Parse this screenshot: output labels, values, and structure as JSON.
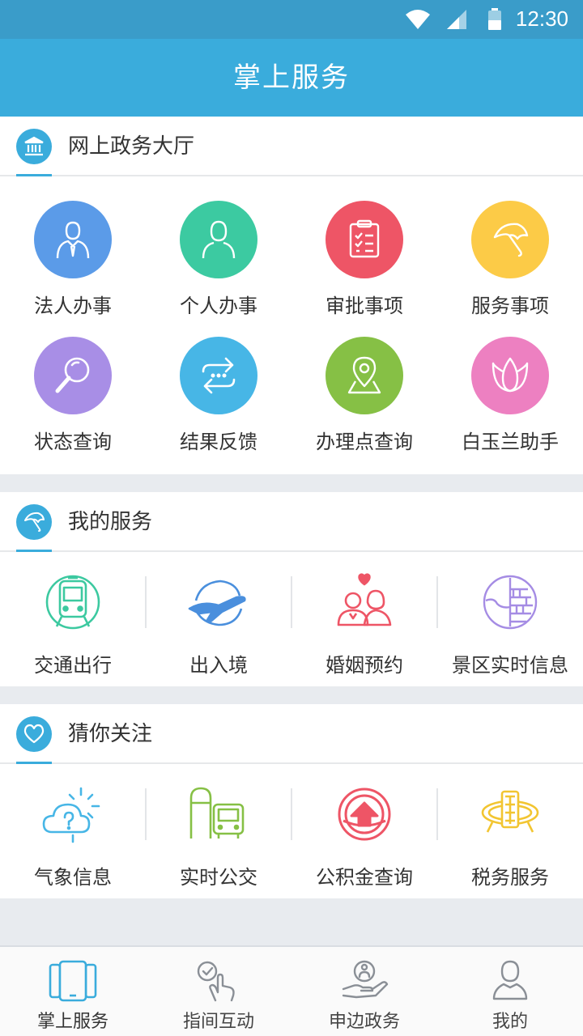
{
  "status_bar": {
    "time": "12:30",
    "icons": [
      "wifi-icon",
      "signal-icon",
      "battery-icon"
    ]
  },
  "header": {
    "title": "掌上服务"
  },
  "hall": {
    "title": "网上政务大厅",
    "icon": "government-building-icon",
    "items": [
      {
        "label": "法人办事",
        "icon": "businessman-icon",
        "color": "#5b9be8"
      },
      {
        "label": "个人办事",
        "icon": "person-icon",
        "color": "#3ccaa1"
      },
      {
        "label": "审批事项",
        "icon": "clipboard-checklist-icon",
        "color": "#ee5566"
      },
      {
        "label": "服务事项",
        "icon": "umbrella-icon",
        "color": "#fccb47"
      },
      {
        "label": "状态查询",
        "icon": "magnifier-icon",
        "color": "#a88ee6"
      },
      {
        "label": "结果反馈",
        "icon": "exchange-arrows-icon",
        "color": "#47b6e6"
      },
      {
        "label": "办理点查询",
        "icon": "map-pin-icon",
        "color": "#86c045"
      },
      {
        "label": "白玉兰助手",
        "icon": "magnolia-flower-icon",
        "color": "#ed80c1"
      }
    ]
  },
  "my_services": {
    "title": "我的服务",
    "icon": "umbrella-icon",
    "items": [
      {
        "label": "交通出行",
        "icon": "metro-train-icon",
        "color": "#3cc9a0"
      },
      {
        "label": "出入境",
        "icon": "airplane-globe-icon",
        "color": "#4a8fdd"
      },
      {
        "label": "婚姻预约",
        "icon": "couple-heart-icon",
        "color": "#ee5566"
      },
      {
        "label": "景区实时信息",
        "icon": "pagoda-scenic-icon",
        "color": "#a58ce4"
      }
    ]
  },
  "recommend": {
    "title": "猜你关注",
    "icon": "heart-icon",
    "items": [
      {
        "label": "气象信息",
        "icon": "weather-cloud-icon",
        "color": "#47b6e6"
      },
      {
        "label": "实时公交",
        "icon": "bus-stop-icon",
        "color": "#86c045"
      },
      {
        "label": "公积金查询",
        "icon": "housing-fund-icon",
        "color": "#ee5566"
      },
      {
        "label": "税务服务",
        "icon": "tax-emblem-icon",
        "color": "#f2c531"
      }
    ]
  },
  "tabbar": {
    "items": [
      {
        "label": "掌上服务",
        "icon": "phone-tablet-icon",
        "active": true
      },
      {
        "label": "指间互动",
        "icon": "finger-tap-icon",
        "active": false
      },
      {
        "label": "申边政务",
        "icon": "hand-service-icon",
        "active": false
      },
      {
        "label": "我的",
        "icon": "user-profile-icon",
        "active": false
      }
    ]
  }
}
